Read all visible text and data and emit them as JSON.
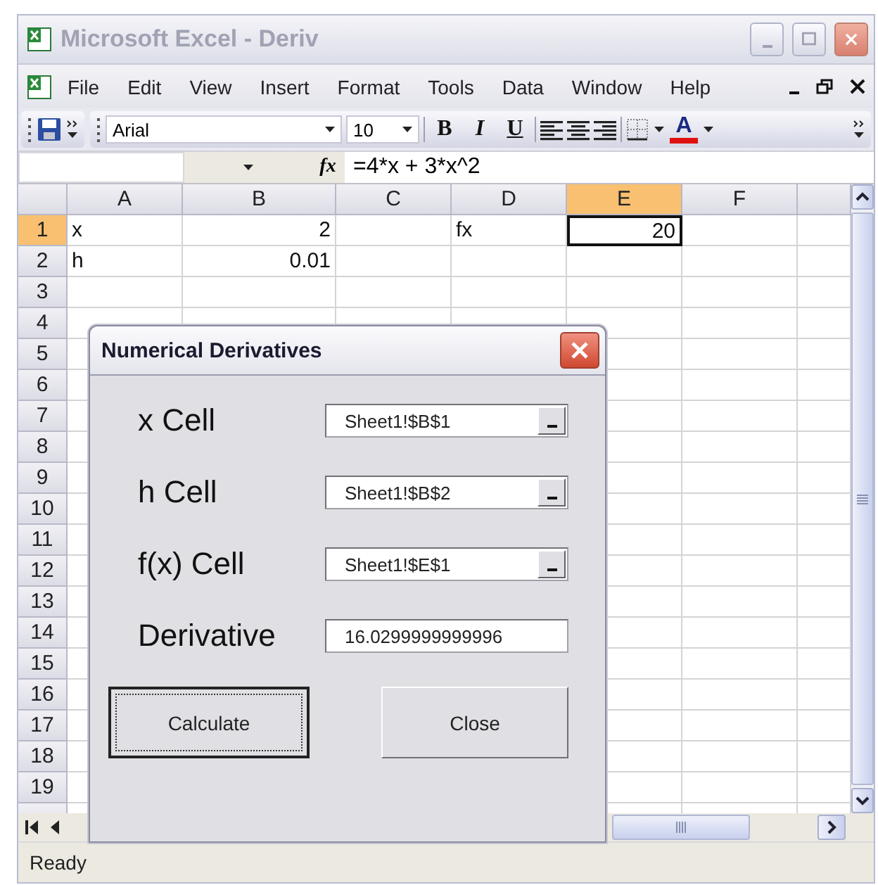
{
  "window": {
    "title": "Microsoft Excel - Deriv"
  },
  "menu": [
    "File",
    "Edit",
    "View",
    "Insert",
    "Format",
    "Tools",
    "Data",
    "Window",
    "Help"
  ],
  "toolbar": {
    "font": "Arial",
    "font_size": "10",
    "format_buttons": [
      {
        "kind": "bold",
        "label": "B"
      },
      {
        "kind": "italic",
        "label": "I"
      },
      {
        "kind": "underline",
        "label": "U"
      }
    ],
    "font_color_label": "A"
  },
  "formula_bar": {
    "fx_label": "fx",
    "formula": "=4*x + 3*x^2"
  },
  "sheet": {
    "columns": [
      {
        "label": "A",
        "selected": false
      },
      {
        "label": "B",
        "selected": false
      },
      {
        "label": "C",
        "selected": false
      },
      {
        "label": "D",
        "selected": false
      },
      {
        "label": "E",
        "selected": true
      },
      {
        "label": "F",
        "selected": false
      }
    ],
    "rows": [
      {
        "label": "1",
        "selected": true,
        "cells": [
          {
            "kind": "text",
            "value": "x",
            "active": false
          },
          {
            "kind": "number",
            "value": "2",
            "active": false
          },
          {
            "kind": "empty",
            "active": false
          },
          {
            "kind": "text",
            "value": "fx",
            "active": false
          },
          {
            "kind": "number",
            "value": "20",
            "active": true
          },
          {
            "kind": "empty",
            "active": false
          }
        ]
      },
      {
        "label": "2",
        "selected": false,
        "cells": [
          {
            "kind": "text",
            "value": "h",
            "active": false
          },
          {
            "kind": "number",
            "value": "0.01",
            "active": false
          },
          {
            "kind": "empty",
            "active": false
          },
          {
            "kind": "empty",
            "active": false
          },
          {
            "kind": "empty",
            "active": false
          },
          {
            "kind": "empty",
            "active": false
          }
        ]
      },
      {
        "label": "3",
        "selected": false
      },
      {
        "label": "4",
        "selected": false
      },
      {
        "label": "5",
        "selected": false
      },
      {
        "label": "6",
        "selected": false
      },
      {
        "label": "7",
        "selected": false
      },
      {
        "label": "8",
        "selected": false
      },
      {
        "label": "9",
        "selected": false
      },
      {
        "label": "10",
        "selected": false
      },
      {
        "label": "11",
        "selected": false
      },
      {
        "label": "12",
        "selected": false
      },
      {
        "label": "13",
        "selected": false
      },
      {
        "label": "14",
        "selected": false
      },
      {
        "label": "15",
        "selected": false
      },
      {
        "label": "16",
        "selected": false
      },
      {
        "label": "17",
        "selected": false
      },
      {
        "label": "18",
        "selected": false
      },
      {
        "label": "19",
        "selected": false
      }
    ]
  },
  "dialog": {
    "title": "Numerical Derivatives",
    "fields": [
      {
        "kind": "ref",
        "label": "x Cell",
        "value": "Sheet1!$B$1"
      },
      {
        "kind": "ref",
        "label": "h Cell",
        "value": "Sheet1!$B$2"
      },
      {
        "kind": "ref",
        "label": "f(x) Cell",
        "value": "Sheet1!$E$1"
      },
      {
        "kind": "plain",
        "label": "Derivative",
        "value": "16.0299999999996"
      }
    ],
    "buttons": [
      {
        "label": "Calculate",
        "focused": true
      },
      {
        "label": "Close",
        "focused": false
      }
    ]
  },
  "status_bar": {
    "text": "Ready"
  }
}
